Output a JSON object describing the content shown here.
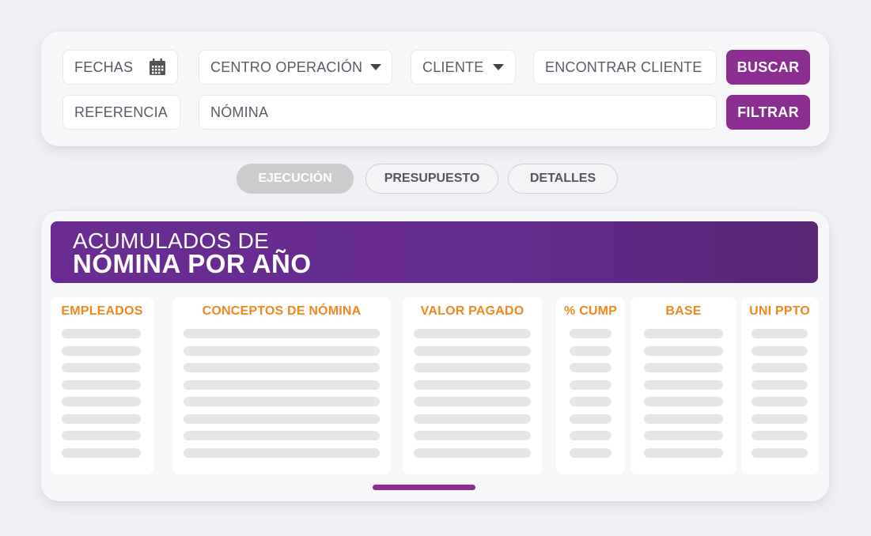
{
  "filters": {
    "fechas_label": "FECHAS",
    "centro_operacion_label": "CENTRO OPERACIÓN",
    "cliente_label": "CLIENTE",
    "encontrar_cliente_placeholder": "ENCONTRAR CLIENTE",
    "buscar_label": "BUSCAR",
    "referencia_label": "REFERENCIA",
    "nomina_placeholder": "NÓMINA",
    "filtrar_label": "FILTRAR"
  },
  "tabs": [
    {
      "label": "EJECUCIÓN",
      "active": true
    },
    {
      "label": "PRESUPUESTO",
      "active": false
    },
    {
      "label": "DETALLES",
      "active": false
    }
  ],
  "banner": {
    "line1": "ACUMULADOS DE",
    "line2": "NÓMINA POR AÑO"
  },
  "table": {
    "columns": [
      "EMPLEADOS",
      "CONCEPTOS DE NÓMINA",
      "VALOR PAGADO",
      "% CUMP",
      "BASE",
      "UNI PPTO"
    ],
    "placeholder_rows": 8
  },
  "icons": {
    "calendar": "calendar-icon",
    "dropdown": "chevron-down-icon"
  },
  "colors": {
    "accent": "#8c2d91",
    "banner": "#6a2c92",
    "column_header": "#f0861e",
    "placeholder": "#e6e6e9"
  }
}
